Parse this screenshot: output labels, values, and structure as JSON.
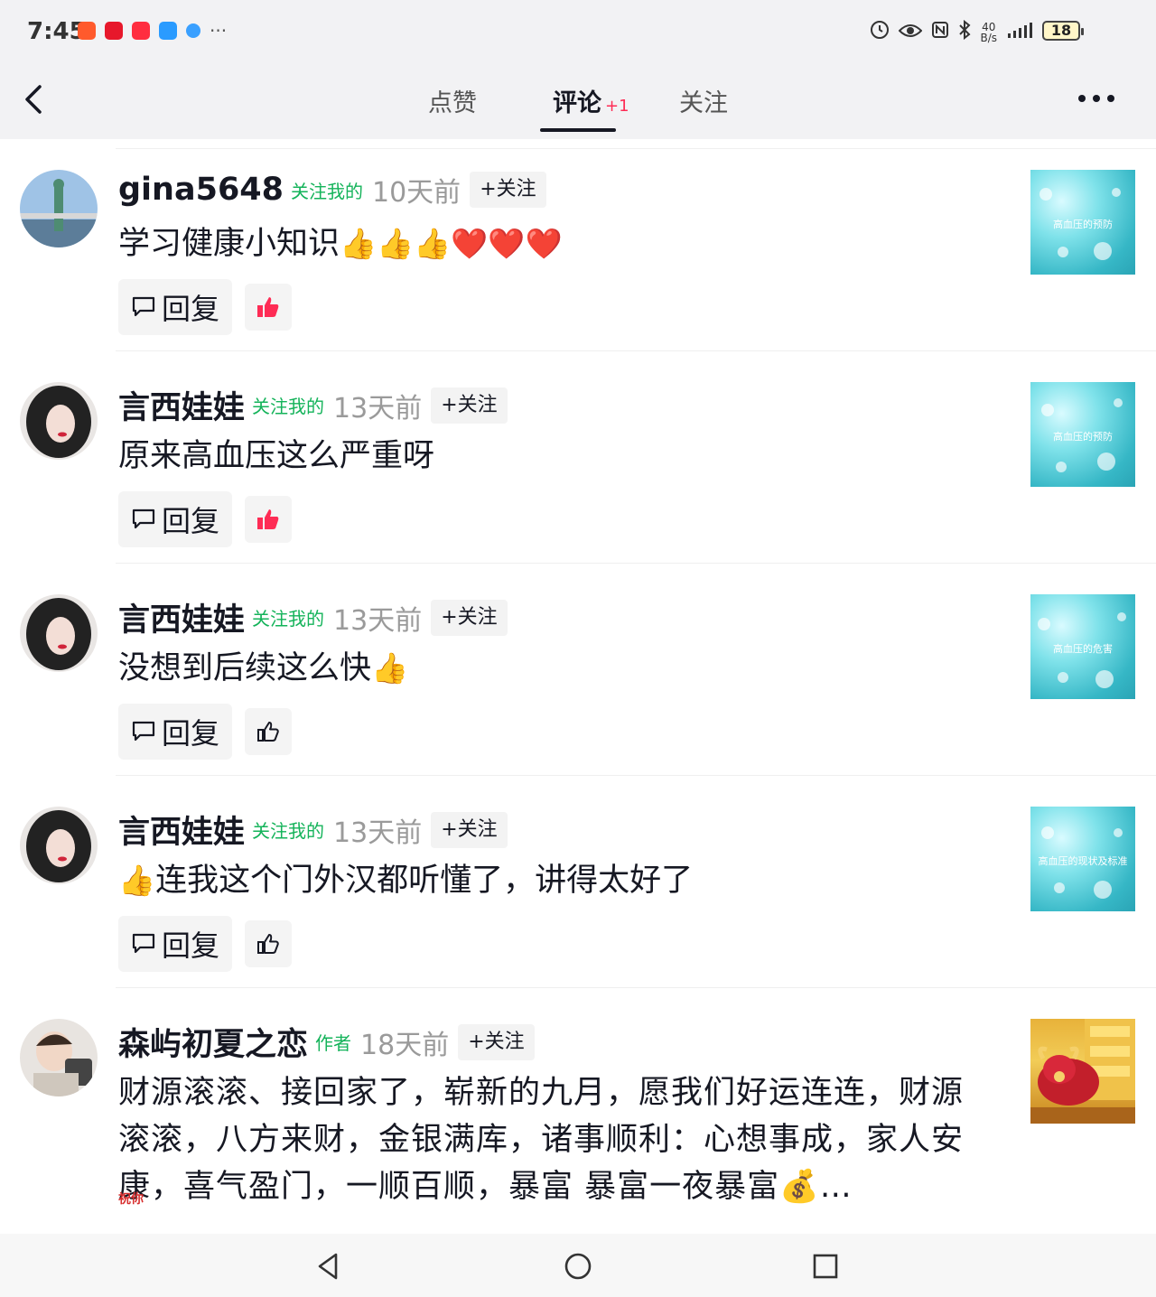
{
  "status_bar": {
    "time": "7:45",
    "net_speed": "40\nB/s",
    "battery": "18",
    "icons": [
      "alarm-icon",
      "eye-icon",
      "nfc-icon",
      "bluetooth-icon",
      "signal-icon",
      "4g-signal-icon"
    ]
  },
  "nav": {
    "tabs": [
      {
        "label": "点赞"
      },
      {
        "label": "评论",
        "badge": "+1"
      },
      {
        "label": "关注"
      }
    ],
    "active_tab": "评论"
  },
  "comments": [
    {
      "username": "gina5648",
      "tag": "关注我的",
      "time": "10天前",
      "follow_label": "+关注",
      "text": "学习健康小知识",
      "emojis": "👍👍👍❤️❤️❤️",
      "reply_label": "回复",
      "liked": true,
      "thumb_title": "高血压的预防"
    },
    {
      "username": "言西娃娃",
      "tag": "关注我的",
      "time": "13天前",
      "follow_label": "+关注",
      "text": "原来高血压这么严重呀",
      "reply_label": "回复",
      "liked": true,
      "thumb_title": "高血压的预防"
    },
    {
      "username": "言西娃娃",
      "tag": "关注我的",
      "time": "13天前",
      "follow_label": "+关注",
      "text": "没想到后续这么快",
      "emojis": "👍",
      "reply_label": "回复",
      "liked": false,
      "thumb_title": "高血压的危害"
    },
    {
      "username": "言西娃娃",
      "tag": "关注我的",
      "time": "13天前",
      "follow_label": "+关注",
      "lead_emoji": "👍",
      "text": "连我这个门外汉都听懂了，讲得太好了",
      "reply_label": "回复",
      "liked": false,
      "thumb_title": "高血压的现状及标准"
    },
    {
      "username": "森屿初夏之恋",
      "tag": "作者",
      "time": "18天前",
      "follow_label": "+关注",
      "text": "财源滚滚、接回家了，崭新的九月，愿我们好运连连，财源滚滚，八方来财，金银满库，诸事顺利：心想事成，家人安康，喜气盈门，一顺百顺，暴富 暴富一夜暴富💰…",
      "small_tag": "祝你"
    }
  ],
  "colors": {
    "accent": "#fe2c55",
    "tag_green": "#14b35a",
    "text_primary": "#161823",
    "text_secondary": "#9a9a9a",
    "like_red": "#fe2c55"
  }
}
